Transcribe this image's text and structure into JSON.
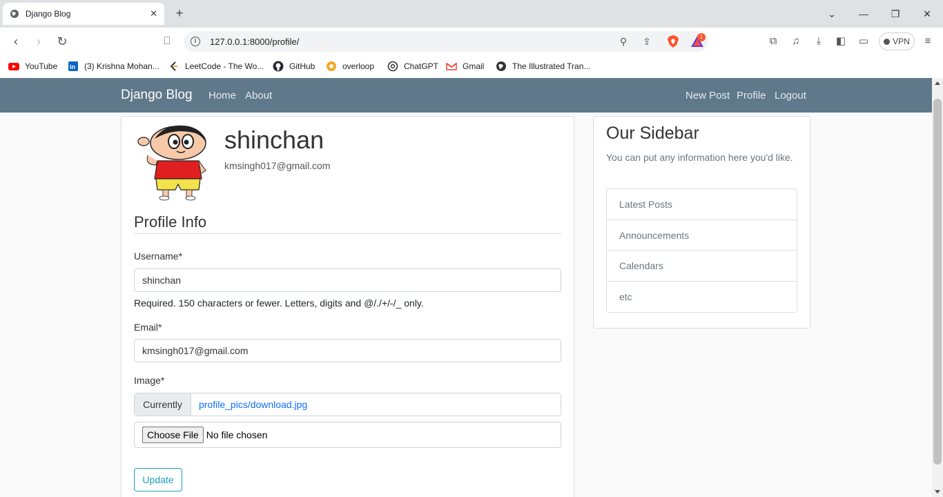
{
  "browser": {
    "tab_title": "Django Blog",
    "url": "127.0.0.1:8000/profile/",
    "brave_badge_count": "1",
    "vpn_label": "VPN"
  },
  "bookmarks": [
    {
      "label": "YouTube",
      "icon": "youtube-icon"
    },
    {
      "label": "(3) Krishna Mohan...",
      "icon": "linkedin-icon"
    },
    {
      "label": "LeetCode - The Wo...",
      "icon": "leetcode-icon"
    },
    {
      "label": "GitHub",
      "icon": "github-icon"
    },
    {
      "label": "overloop",
      "icon": "overloop-icon"
    },
    {
      "label": "ChatGPT",
      "icon": "chatgpt-icon"
    },
    {
      "label": "Gmail",
      "icon": "gmail-icon"
    },
    {
      "label": "The Illustrated Tran...",
      "icon": "globe-icon"
    }
  ],
  "site_nav": {
    "brand": "Django Blog",
    "left_links": [
      "Home",
      "About"
    ],
    "right_links": [
      "New Post",
      "Profile",
      "Logout"
    ]
  },
  "profile": {
    "username": "shinchan",
    "email": "kmsingh017@gmail.com"
  },
  "form": {
    "section_title": "Profile Info",
    "username_label": "Username*",
    "username_value": "shinchan",
    "username_help": "Required. 150 characters or fewer. Letters, digits and @/./+/-/_ only.",
    "email_label": "Email*",
    "email_value": "kmsingh017@gmail.com",
    "image_label": "Image*",
    "currently_label": "Currently",
    "current_image": "profile_pics/download.jpg",
    "choose_file_label": "Choose File",
    "file_status": "No file chosen",
    "submit_label": "Update"
  },
  "sidebar": {
    "title": "Our Sidebar",
    "description": "You can put any information here you'd like.",
    "items": [
      "Latest Posts",
      "Announcements",
      "Calendars",
      "etc"
    ]
  },
  "colors": {
    "navbar_bg": "#5f788a",
    "accent_info": "#17a2b8",
    "link": "#0d6efd"
  }
}
